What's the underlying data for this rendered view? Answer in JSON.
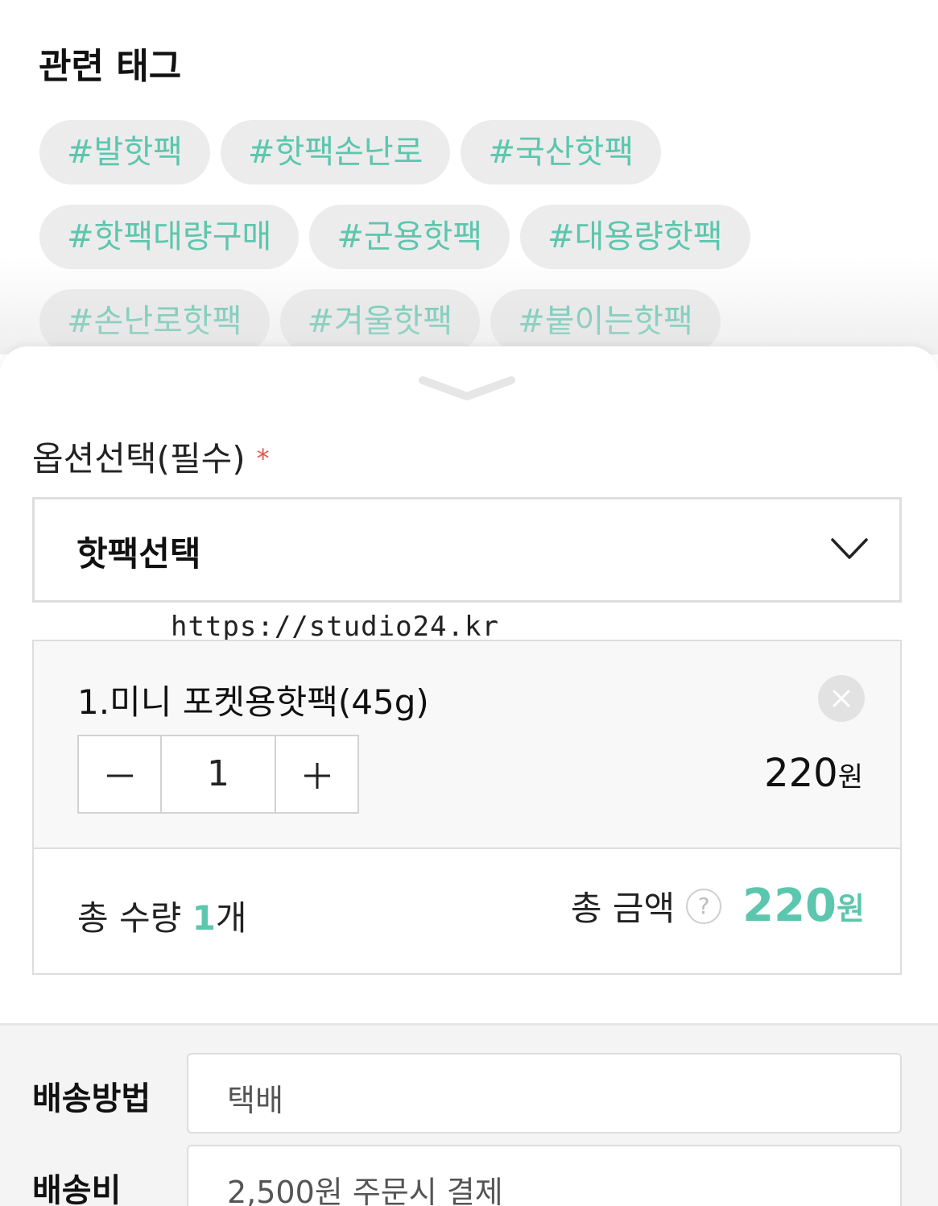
{
  "tags": {
    "title": "관련 태그",
    "rows": [
      [
        "#발핫팩",
        "#핫팩손난로",
        "#국산핫팩"
      ],
      [
        "#핫팩대량구매",
        "#군용핫팩",
        "#대용량핫팩"
      ],
      [
        "#손난로핫팩",
        "#겨울핫팩",
        "#붙이는핫팩"
      ]
    ]
  },
  "option": {
    "label": "옵션선택(필수)",
    "required_mark": "*",
    "select_value": "핫팩선택"
  },
  "watermark_url": "https://studio24.kr",
  "item": {
    "name": "1.미니 포켓용핫팩(45g)",
    "quantity": "1",
    "price": "220",
    "currency": "원"
  },
  "totals": {
    "qty_label": "총 수량",
    "qty_value": "1",
    "qty_unit": "개",
    "amount_label": "총 금액",
    "help_glyph": "?",
    "amount_value": "220",
    "amount_currency": "원"
  },
  "shipping": {
    "method_label": "배송방법",
    "method_value": "택배",
    "fee_label": "배송비",
    "fee_value": "2,500원 주문시 결제"
  },
  "colors": {
    "accent": "#5cc6ae",
    "required": "#e05a4e",
    "tag_bg": "#ececec"
  }
}
